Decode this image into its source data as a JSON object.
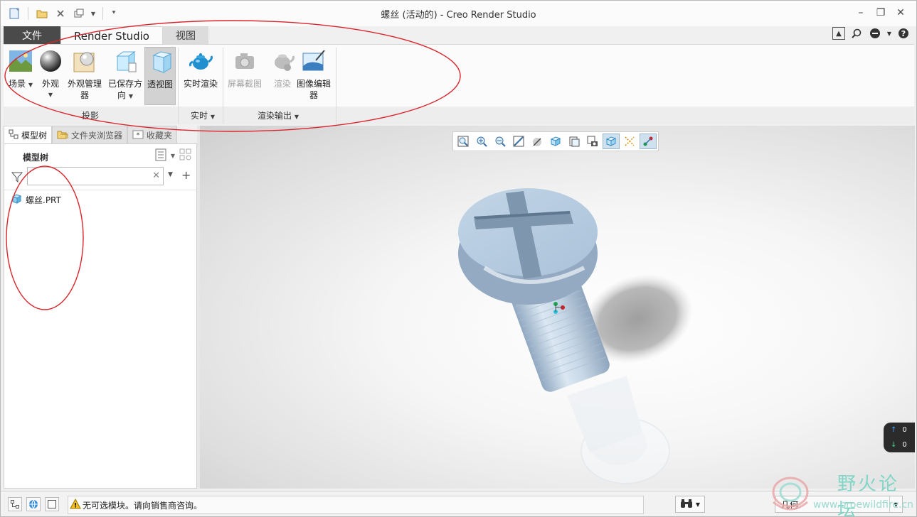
{
  "window": {
    "title": "螺丝 (活动的) - Creo Render Studio"
  },
  "ribbon_tabs": {
    "file": "文件",
    "render_studio": "Render Studio",
    "view": "视图"
  },
  "ribbon": {
    "scene": "场景",
    "appearance": "外观",
    "appearance_manager_1": "外观管理",
    "appearance_manager_2": "器",
    "saved_orient_1": "已保存方",
    "saved_orient_2": "向",
    "perspective": "透视图",
    "realtime_render": "实时渲染",
    "screenshot": "屏幕截图",
    "render": "渲染",
    "image_editor_1": "图像编辑",
    "image_editor_2": "器",
    "group_projection": "投影",
    "group_realtime": "实时",
    "group_render_output": "渲染输出"
  },
  "left_panel": {
    "tabs": [
      "模型树",
      "文件夹浏览器",
      "收藏夹"
    ],
    "header": "模型树",
    "search_value": "",
    "tree_items": [
      "螺丝.PRT"
    ]
  },
  "viewport": {
    "updown": [
      "0",
      "0"
    ]
  },
  "statusbar": {
    "message": "无可选模块。请向销售商咨询。",
    "filter_value": "几何"
  },
  "watermark": {
    "title": "野火论坛",
    "url": "www.proewildfire.cn"
  },
  "colors": {
    "file_tab": "#4a4a4a",
    "annotation": "#d9252b",
    "screw": "#b9cde0",
    "watermark": "#7fd6c7"
  }
}
